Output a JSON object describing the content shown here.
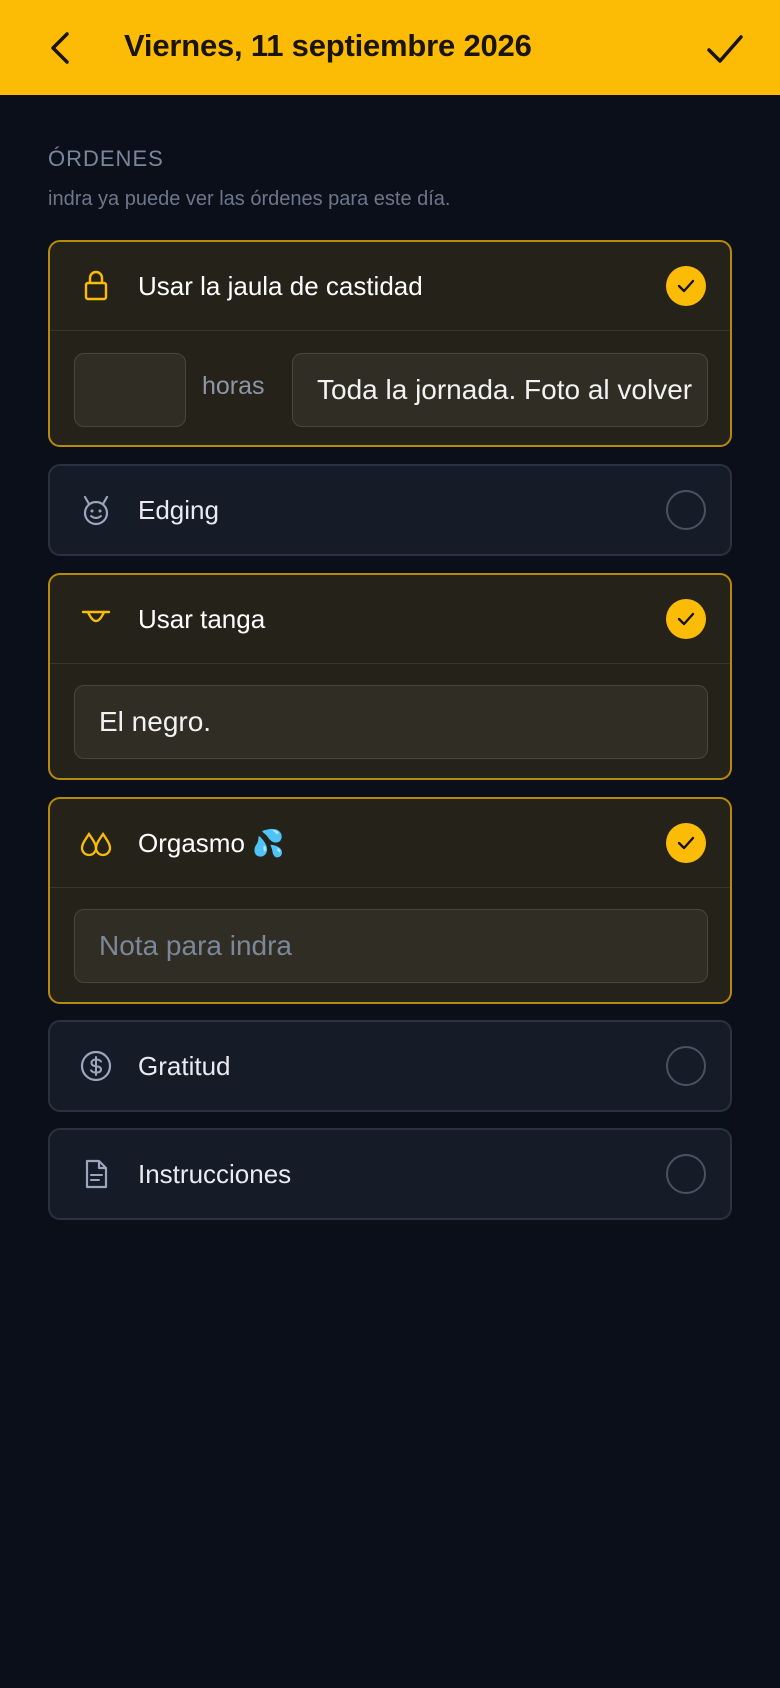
{
  "header": {
    "title": "Viernes, 11 septiembre 2026",
    "background": "#fcbc05",
    "back_icon": "chevron-left-icon",
    "confirm_icon": "check-icon"
  },
  "section": {
    "title": "ÓRDENES",
    "subtitle": "indra ya puede ver las órdenes para este día."
  },
  "items": [
    {
      "label": "Usar la jaula de castidad",
      "icon": "lock-icon",
      "checked": true,
      "hours_value": "",
      "hours_label": "horas",
      "note_value": "Toda la jornada. Foto al volver"
    },
    {
      "label": "Edging",
      "icon": "devil-face-icon",
      "checked": false
    },
    {
      "label": "Usar tanga",
      "icon": "thong-icon",
      "checked": true,
      "note_value": "El negro."
    },
    {
      "label": "Orgasmo 💦",
      "icon": "drops-icon",
      "checked": true,
      "note_placeholder": "Nota para indra"
    },
    {
      "label": "Gratitud",
      "icon": "dollar-circle-icon",
      "checked": false
    },
    {
      "label": "Instrucciones",
      "icon": "document-icon",
      "checked": false
    }
  ],
  "colors": {
    "accent": "#fcbc05",
    "background": "#0b0f19",
    "card_active_border": "#b88a0b"
  }
}
